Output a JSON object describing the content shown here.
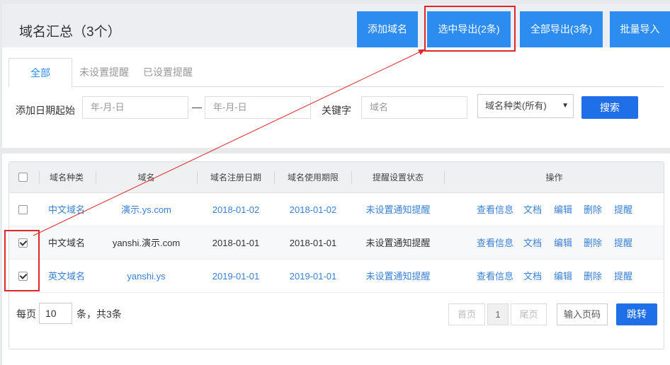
{
  "header": {
    "title": "域名汇总（3个）",
    "buttons": {
      "add": "添加域名",
      "export_selected": "选中导出(2条)",
      "export_all": "全部导出(3条)",
      "batch_import": "批量导入"
    }
  },
  "tabs": [
    "全部",
    "未设置提醒",
    "已设置提醒"
  ],
  "filter": {
    "date_label": "添加日期起始",
    "date_start_placeholder": "年-月-日",
    "date_sep": "—",
    "date_end_placeholder": "年-月-日",
    "keyword_label": "关键字",
    "keyword_placeholder": "域名",
    "type_select": "域名种类(所有)",
    "search": "搜索"
  },
  "table": {
    "columns": [
      "域名种类",
      "域名",
      "域名注册日期",
      "域名使用期限",
      "提醒设置状态",
      "操作"
    ],
    "rows": [
      {
        "checked": false,
        "type": "中文域名",
        "domain": "演示.ys.com",
        "reg": "2018-01-02",
        "exp": "2018-01-02",
        "status": "未设置通知提醒",
        "link": true
      },
      {
        "checked": true,
        "type": "中文域名",
        "domain": "yanshi.演示.com",
        "reg": "2018-01-01",
        "exp": "2018-01-01",
        "status": "未设置通知提醒",
        "link": false
      },
      {
        "checked": true,
        "type": "英文域名",
        "domain": "yanshi.ys",
        "reg": "2019-01-01",
        "exp": "2019-01-01",
        "status": "未设置通知提醒",
        "link": true
      }
    ],
    "ops": [
      "查看信息",
      "文档",
      "编辑",
      "删除",
      "提醒"
    ]
  },
  "pager": {
    "per_page_label": "每页",
    "per_page_value": "10",
    "count_text": "条，共3条",
    "first": "首页",
    "current": "1",
    "last": "尾页",
    "input_page": "输入页码",
    "jump": "跳转"
  },
  "colors": {
    "primary": "#2d8cf0",
    "link": "#3a80d6",
    "annotation": "#e0262b"
  }
}
